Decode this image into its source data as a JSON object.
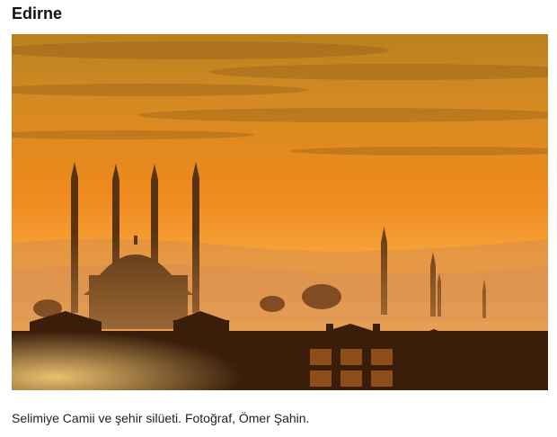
{
  "article": {
    "title": "Edirne",
    "image": {
      "subject": "Selimiye Mosque and city silhouette at sunset",
      "colors": {
        "sky_top": "#c98a1c",
        "sky_mid": "#f08a1e",
        "horizon": "#f6a63a",
        "haze": "#e9a04c",
        "silhouette": "#3a1e0a"
      }
    },
    "caption": "Selimiye Camii ve şehir silüeti. Fotoğraf, Ömer Şahin."
  }
}
